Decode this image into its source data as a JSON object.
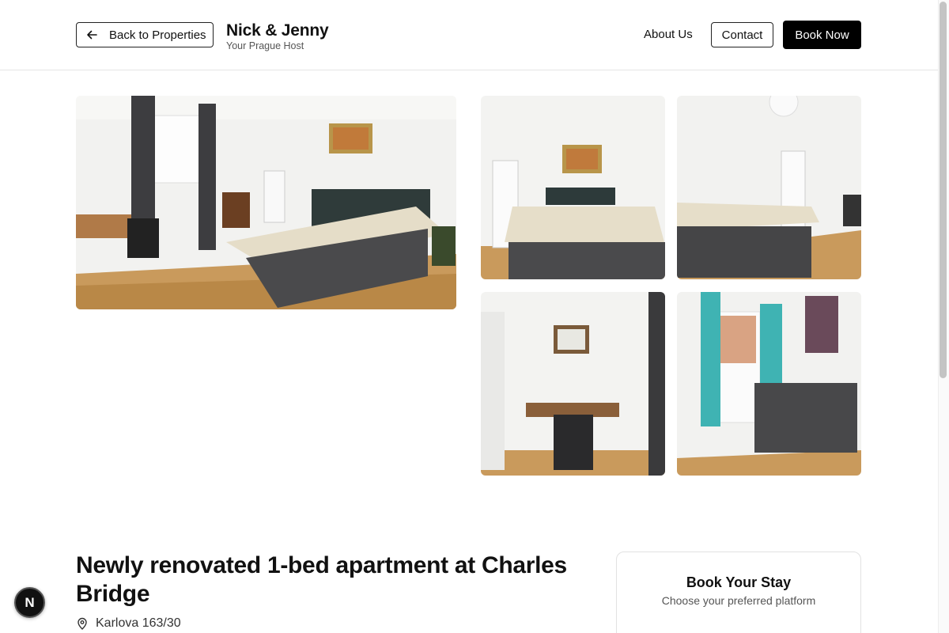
{
  "header": {
    "back_label": "Back to Properties",
    "brand_name": "Nick & Jenny",
    "brand_tagline": "Your Prague Host",
    "nav_about": "About Us",
    "nav_contact": "Contact",
    "nav_book": "Book Now"
  },
  "gallery": {
    "photos": [
      "bedroom-wide",
      "bedroom-front",
      "bedroom-angle",
      "desk-corner",
      "living-sofa"
    ]
  },
  "listing": {
    "title": "Newly renovated 1-bed apartment at Charles Bridge",
    "address": "Karlova 163/30"
  },
  "booking": {
    "title": "Book Your Stay",
    "subtitle": "Choose your preferred platform"
  },
  "badge": {
    "label": "N"
  },
  "colors": {
    "accent": "#000000",
    "background": "#ffffff",
    "border": "#e5e5e5"
  },
  "icons": [
    "arrow-left-icon",
    "map-pin-icon"
  ]
}
